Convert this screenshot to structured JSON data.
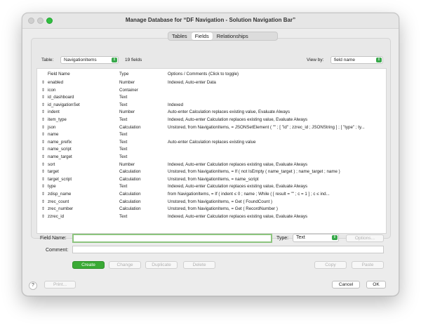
{
  "window": {
    "title": "Manage Database for “DF Navigation - Solution Navigation Bar”"
  },
  "tabs": [
    {
      "label": "Tables",
      "active": false
    },
    {
      "label": "Fields",
      "active": true
    },
    {
      "label": "Relationships",
      "active": false
    }
  ],
  "table_selector": {
    "label": "Table:",
    "value": "NavigationItems",
    "count": "19 fields"
  },
  "view_by": {
    "label": "View by:",
    "value": "field name"
  },
  "columns": {
    "name": "Field Name",
    "type": "Type",
    "options": "Options / Comments   (Click to toggle)"
  },
  "fields": [
    {
      "name": "enabled",
      "type": "Number",
      "options": "Indexed, Auto-enter Data"
    },
    {
      "name": "icon",
      "type": "Container",
      "options": ""
    },
    {
      "name": "id_dashboard",
      "type": "Text",
      "options": ""
    },
    {
      "name": "id_navigationSet",
      "type": "Text",
      "options": "Indexed"
    },
    {
      "name": "indent",
      "type": "Number",
      "options": "Auto-enter Calculation replaces existing value, Evaluate Always"
    },
    {
      "name": "item_type",
      "type": "Text",
      "options": "Indexed, Auto-enter Calculation replaces existing value, Evaluate Always"
    },
    {
      "name": "json",
      "type": "Calculation",
      "options": "Unstored, from NavigationItems, = JSONSetElement ( \"\" ;  [ \"id\" ; zzrec_id ; JSONString ] ; [ \"type\" ; ty..."
    },
    {
      "name": "name",
      "type": "Text",
      "options": ""
    },
    {
      "name": "name_prefix",
      "type": "Text",
      "options": "Auto-enter Calculation replaces existing value"
    },
    {
      "name": "name_script",
      "type": "Text",
      "options": ""
    },
    {
      "name": "name_target",
      "type": "Text",
      "options": ""
    },
    {
      "name": "sort",
      "type": "Number",
      "options": "Indexed, Auto-enter Calculation replaces existing value, Evaluate Always"
    },
    {
      "name": "target",
      "type": "Calculation",
      "options": "Unstored, from NavigationItems, = If (   not IsEmpty ( name_target ) ; name_target ;  name  )"
    },
    {
      "name": "target_script",
      "type": "Calculation",
      "options": "Unstored, from NavigationItems, = name_script"
    },
    {
      "name": "type",
      "type": "Text",
      "options": "Indexed, Auto-enter Calculation replaces existing value, Evaluate Always"
    },
    {
      "name": "zdisp_name",
      "type": "Calculation",
      "options": "from NavigationItems, = If (        indent ≤ 0 ;        name ;                  While ( [ result = \"\" ; c = 1 ] ; c ≤ ind..."
    },
    {
      "name": "zrec_count",
      "type": "Calculation",
      "options": "Unstored, from NavigationItems, = Get ( FoundCount )"
    },
    {
      "name": "zrec_number",
      "type": "Calculation",
      "options": "Unstored, from NavigationItems, = Get ( RecordNumber )"
    },
    {
      "name": "zzrec_id",
      "type": "Text",
      "options": "Indexed, Auto-enter Calculation replaces existing value, Evaluate Always"
    }
  ],
  "form": {
    "field_name_label": "Field Name:",
    "field_name_value": "",
    "type_label": "Type:",
    "type_value": "Text",
    "options_button": "Options...",
    "comment_label": "Comment:",
    "comment_value": ""
  },
  "actions": {
    "create": "Create",
    "change": "Change",
    "duplicate": "Duplicate",
    "delete": "Delete",
    "copy": "Copy",
    "paste": "Paste"
  },
  "footer": {
    "help": "?",
    "print": "Print...",
    "cancel": "Cancel",
    "ok": "OK"
  },
  "colors": {
    "accent_green": "#3aaa35",
    "focus_ring": "#8cc47e"
  }
}
